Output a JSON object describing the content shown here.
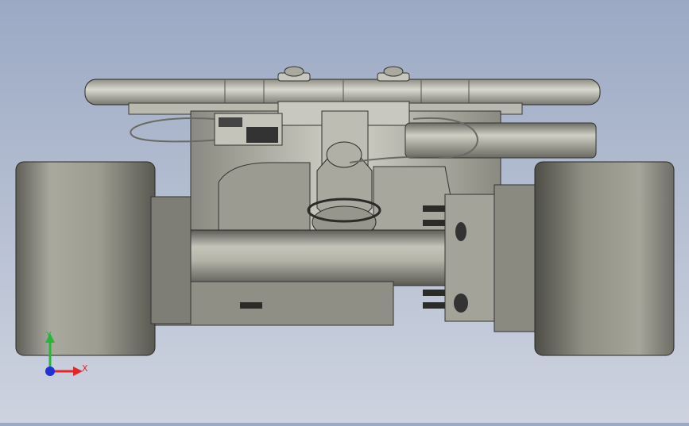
{
  "viewport": {
    "background_top": "#9ba9c4",
    "background_bottom": "#cdd3df",
    "model": "electric-skateboard-truck-assembly-front-view"
  },
  "triad": {
    "x_label": "X",
    "y_label": "Y",
    "x_color": "#e0282a",
    "y_color": "#27b53a",
    "z_color": "#2230d8"
  }
}
